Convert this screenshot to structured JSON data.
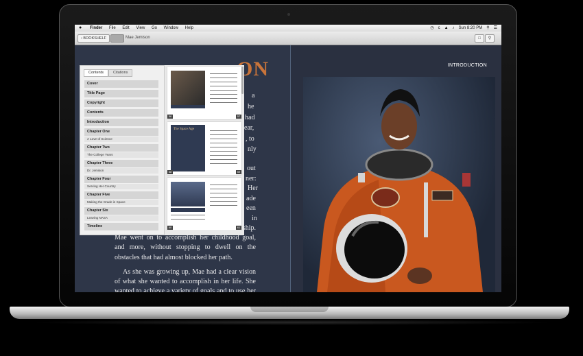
{
  "menubar": {
    "apple": "",
    "items": [
      "Finder",
      "File",
      "Edit",
      "View",
      "Go",
      "Window",
      "Help"
    ],
    "clock": "Sun 8:20 PM"
  },
  "toolbar": {
    "bookshelf_label": "‹ BOOKSHELF",
    "book_title": "Mae Jemison"
  },
  "sidebar": {
    "tabs": [
      "Contents",
      "Citations"
    ],
    "toc": [
      {
        "label": "Cover"
      },
      {
        "label": "Title Page"
      },
      {
        "label": "Copyright"
      },
      {
        "label": "Contents"
      },
      {
        "label": "Introduction"
      },
      {
        "label": "Chapter One",
        "sub": "A Love of Science"
      },
      {
        "label": "Chapter Two",
        "sub": "The College Years"
      },
      {
        "label": "Chapter Three",
        "sub": "Dr. Jemison"
      },
      {
        "label": "Chapter Four",
        "sub": "Serving Her Country"
      },
      {
        "label": "Chapter Five",
        "sub": "Making the Grade in Space"
      },
      {
        "label": "Chapter Six",
        "sub": "Leaving NASA"
      },
      {
        "label": "Timeline"
      }
    ]
  },
  "thumbnails": [
    {
      "left_num": "56",
      "right_num": "57"
    },
    {
      "left_num": "58",
      "right_num": "59",
      "heading": "The Space Age"
    },
    {
      "left_num": "60",
      "right_num": "61"
    }
  ],
  "page": {
    "chapter_heading": "ON",
    "section_label": "INTRODUCTION",
    "right_edge_words": [
      "a",
      "he",
      "had",
      "ear,",
      ", to",
      "nly",
      "out",
      "ner:",
      "Her",
      "ade",
      "een",
      "in"
    ],
    "paragraph1": "California on a National Achievement Scholarship. Mae went on to accomplish her childhood goal, and more, without stopping to dwell on the obstacles that had almost blocked her path.",
    "paragraph2": "As she was growing up, Mae had a clear vision of what she wanted to accomplish in her life. She wanted to achieve a variety of goals and to use her knowledge to help others. Following her interests, Jemison graduated from Stanford in 1977 with a dual degree in chemical"
  },
  "colors": {
    "accent_heading": "#c9743a",
    "page_bg": "#2e3648"
  }
}
